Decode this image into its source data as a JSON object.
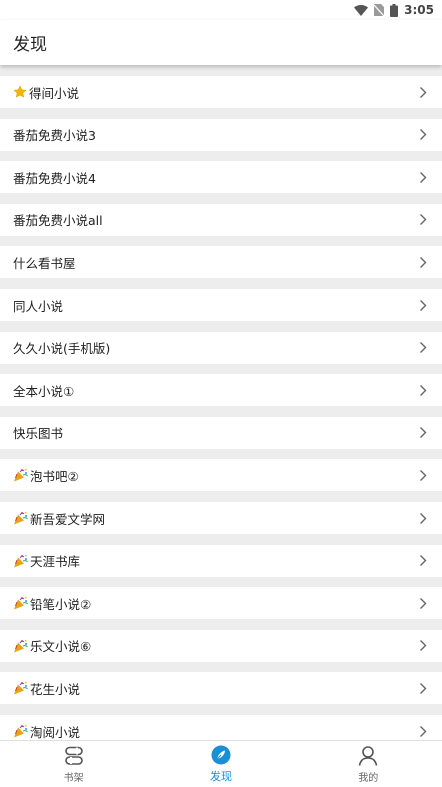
{
  "status_bar": {
    "time": "3:05"
  },
  "header": {
    "title": "发现"
  },
  "list": {
    "items": [
      {
        "label": "得间小说",
        "badge": "star-icon"
      },
      {
        "label": "番茄免费小说3",
        "badge": ""
      },
      {
        "label": "番茄免费小说4",
        "badge": ""
      },
      {
        "label": "番茄免费小说all",
        "badge": ""
      },
      {
        "label": "什么看书屋",
        "badge": ""
      },
      {
        "label": "同人小说",
        "badge": ""
      },
      {
        "label": "久久小说(手机版)",
        "badge": ""
      },
      {
        "label": "全本小说①",
        "badge": ""
      },
      {
        "label": "快乐图书",
        "badge": ""
      },
      {
        "label": "泡书吧②",
        "badge": "party-popper-icon"
      },
      {
        "label": "新吾爱文学网",
        "badge": "party-popper-icon"
      },
      {
        "label": "天涯书库",
        "badge": "party-popper-icon"
      },
      {
        "label": "铅笔小说②",
        "badge": "party-popper-icon"
      },
      {
        "label": "乐文小说⑥",
        "badge": "party-popper-icon"
      },
      {
        "label": "花生小说",
        "badge": "party-popper-icon"
      },
      {
        "label": "淘阅小说",
        "badge": "party-popper-icon"
      }
    ]
  },
  "bottom_nav": {
    "tabs": [
      {
        "label": "书架",
        "icon": "bookshelf-icon",
        "active": false
      },
      {
        "label": "发现",
        "icon": "compass-icon",
        "active": true
      },
      {
        "label": "我的",
        "icon": "person-icon",
        "active": false
      }
    ]
  },
  "colors": {
    "accent": "#1a8fd6",
    "background": "#ededed",
    "row_background": "#ffffff",
    "text": "#222222",
    "star": "#f5b400"
  }
}
